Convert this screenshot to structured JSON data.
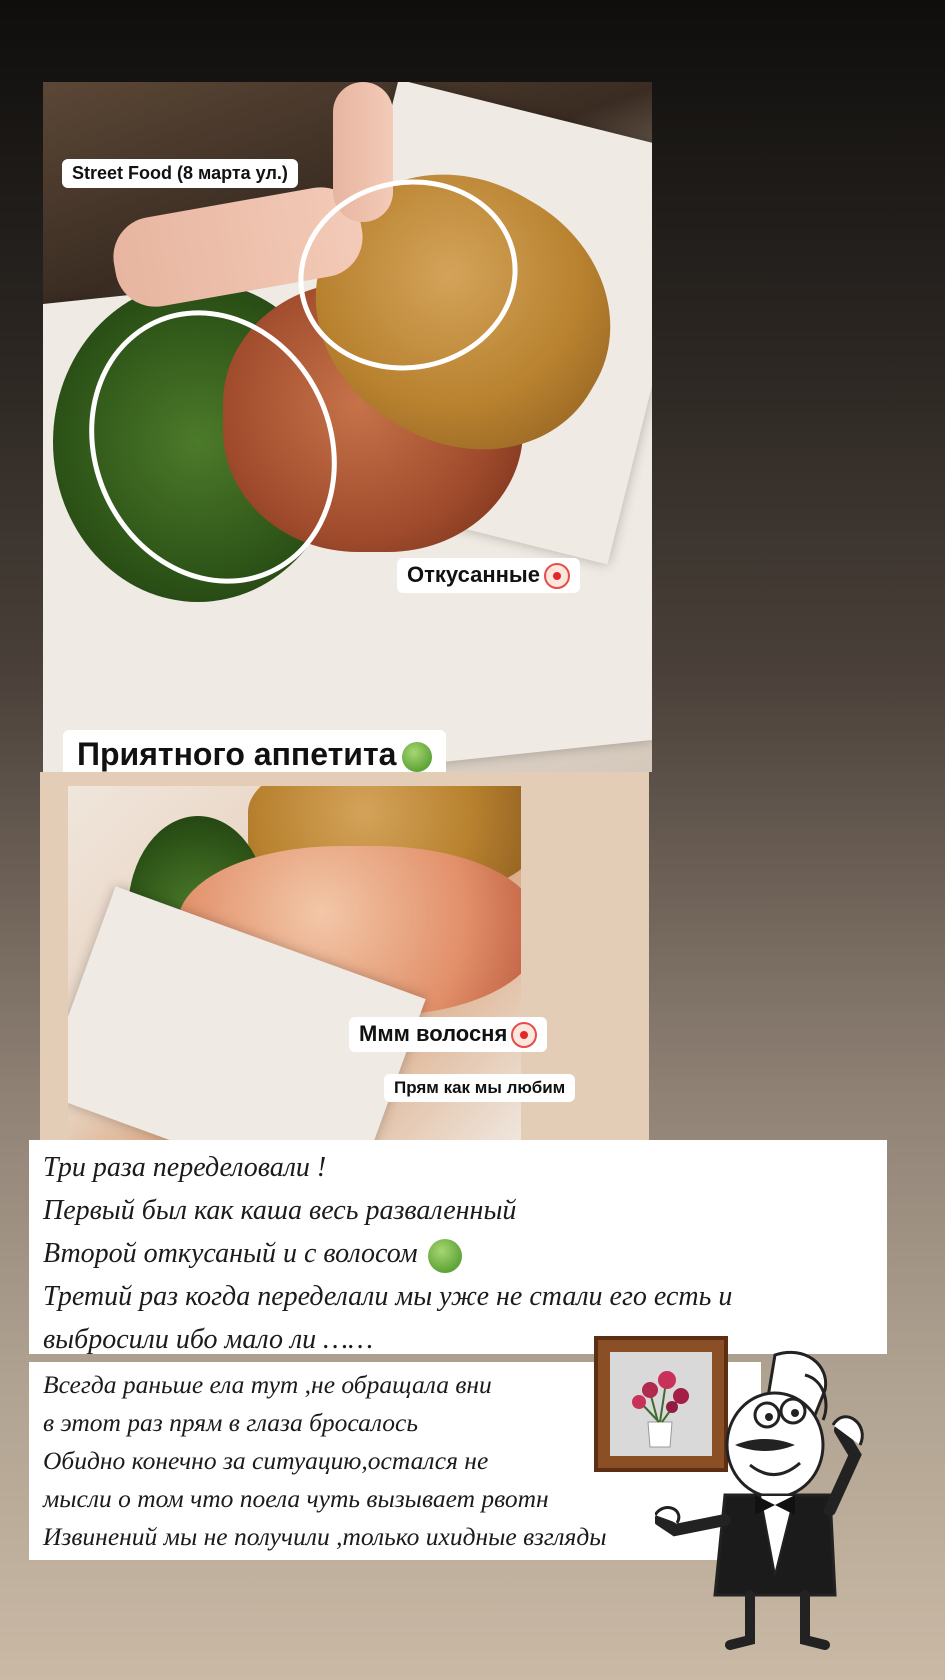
{
  "photo_top": {
    "label_location": "Street Food (8 марта ул.)",
    "label_bitten": "Откусанные",
    "label_appetite": "Приятного аппетита"
  },
  "photo_bottom": {
    "label_hair": "Ммм волосня",
    "label_like": "Прям как мы любим"
  },
  "review_1": {
    "lines": [
      "Три раза переделовали !",
      "Первый был как каша весь разваленный",
      "Второй откусаный и с волосом",
      "Третий раз когда переделали мы уже не стали его есть и",
      "выбросили ибо мало ли ……"
    ]
  },
  "review_2": {
    "lines": [
      "Всегда раньше ела тут ,не обращала вни",
      "в этот раз прям в глаза бросалось",
      "Обидно конечно за ситуацию,остался не",
      "мысли о том что поела чуть вызывает рвотн",
      "Извинений мы не получили ,только ихидные взгляды"
    ]
  },
  "icons": {
    "sick_emoji": "nauseated-face-emoji",
    "clown_emoji": "clown-face-emoji",
    "picture": "framed-flowers-icon",
    "chef": "chef-waiter-icon"
  }
}
